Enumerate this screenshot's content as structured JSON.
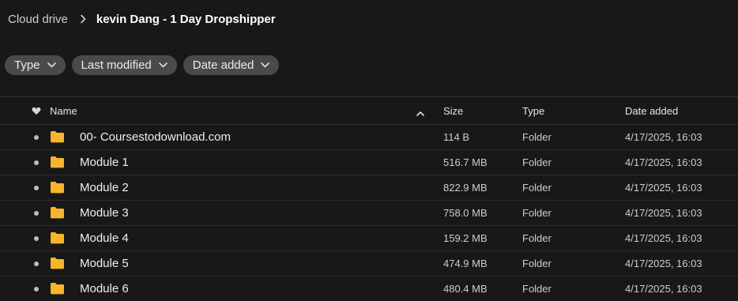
{
  "breadcrumb": {
    "root": "Cloud drive",
    "current": "kevin Dang - 1 Day Dropshipper"
  },
  "filters": [
    {
      "label": "Type"
    },
    {
      "label": "Last modified"
    },
    {
      "label": "Date added"
    }
  ],
  "table": {
    "columns": {
      "name": "Name",
      "size": "Size",
      "type": "Type",
      "date_added": "Date added"
    },
    "sort": {
      "column": "Name",
      "direction": "ascending"
    },
    "rows": [
      {
        "name": "00- Coursestodownload.com",
        "size": "114 B",
        "type": "Folder",
        "date_added": "4/17/2025, 16:03"
      },
      {
        "name": "Module 1",
        "size": "516.7 MB",
        "type": "Folder",
        "date_added": "4/17/2025, 16:03"
      },
      {
        "name": "Module 2",
        "size": "822.9 MB",
        "type": "Folder",
        "date_added": "4/17/2025, 16:03"
      },
      {
        "name": "Module 3",
        "size": "758.0 MB",
        "type": "Folder",
        "date_added": "4/17/2025, 16:03"
      },
      {
        "name": "Module 4",
        "size": "159.2 MB",
        "type": "Folder",
        "date_added": "4/17/2025, 16:03"
      },
      {
        "name": "Module 5",
        "size": "474.9 MB",
        "type": "Folder",
        "date_added": "4/17/2025, 16:03"
      },
      {
        "name": "Module 6",
        "size": "480.4 MB",
        "type": "Folder",
        "date_added": "4/17/2025, 16:03"
      }
    ]
  },
  "colors": {
    "background": "#181818",
    "chip": "#4a4a4a",
    "folder": "#f9b52a",
    "divider": "#333333"
  },
  "icons": {
    "breadcrumb_separator": "chevron-right-icon",
    "chip_dropdown": "chevron-down-icon",
    "favorite_header": "heart-icon",
    "sort": "chevron-up-icon",
    "row_icon": "folder-icon"
  }
}
